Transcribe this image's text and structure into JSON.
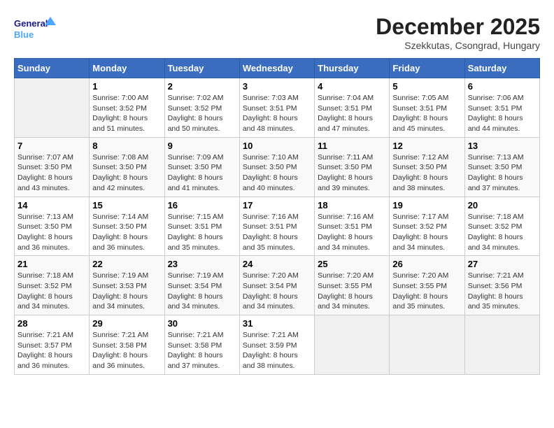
{
  "logo": {
    "line1": "General",
    "line2": "Blue"
  },
  "title": "December 2025",
  "subtitle": "Szekkutas, Csongrad, Hungary",
  "days_of_week": [
    "Sunday",
    "Monday",
    "Tuesday",
    "Wednesday",
    "Thursday",
    "Friday",
    "Saturday"
  ],
  "weeks": [
    [
      {
        "day": "",
        "empty": true
      },
      {
        "day": "1",
        "sunrise": "7:00 AM",
        "sunset": "3:52 PM",
        "daylight": "8 hours and 51 minutes."
      },
      {
        "day": "2",
        "sunrise": "7:02 AM",
        "sunset": "3:52 PM",
        "daylight": "8 hours and 50 minutes."
      },
      {
        "day": "3",
        "sunrise": "7:03 AM",
        "sunset": "3:51 PM",
        "daylight": "8 hours and 48 minutes."
      },
      {
        "day": "4",
        "sunrise": "7:04 AM",
        "sunset": "3:51 PM",
        "daylight": "8 hours and 47 minutes."
      },
      {
        "day": "5",
        "sunrise": "7:05 AM",
        "sunset": "3:51 PM",
        "daylight": "8 hours and 45 minutes."
      },
      {
        "day": "6",
        "sunrise": "7:06 AM",
        "sunset": "3:51 PM",
        "daylight": "8 hours and 44 minutes."
      }
    ],
    [
      {
        "day": "7",
        "sunrise": "7:07 AM",
        "sunset": "3:50 PM",
        "daylight": "8 hours and 43 minutes."
      },
      {
        "day": "8",
        "sunrise": "7:08 AM",
        "sunset": "3:50 PM",
        "daylight": "8 hours and 42 minutes."
      },
      {
        "day": "9",
        "sunrise": "7:09 AM",
        "sunset": "3:50 PM",
        "daylight": "8 hours and 41 minutes."
      },
      {
        "day": "10",
        "sunrise": "7:10 AM",
        "sunset": "3:50 PM",
        "daylight": "8 hours and 40 minutes."
      },
      {
        "day": "11",
        "sunrise": "7:11 AM",
        "sunset": "3:50 PM",
        "daylight": "8 hours and 39 minutes."
      },
      {
        "day": "12",
        "sunrise": "7:12 AM",
        "sunset": "3:50 PM",
        "daylight": "8 hours and 38 minutes."
      },
      {
        "day": "13",
        "sunrise": "7:13 AM",
        "sunset": "3:50 PM",
        "daylight": "8 hours and 37 minutes."
      }
    ],
    [
      {
        "day": "14",
        "sunrise": "7:13 AM",
        "sunset": "3:50 PM",
        "daylight": "8 hours and 36 minutes."
      },
      {
        "day": "15",
        "sunrise": "7:14 AM",
        "sunset": "3:50 PM",
        "daylight": "8 hours and 36 minutes."
      },
      {
        "day": "16",
        "sunrise": "7:15 AM",
        "sunset": "3:51 PM",
        "daylight": "8 hours and 35 minutes."
      },
      {
        "day": "17",
        "sunrise": "7:16 AM",
        "sunset": "3:51 PM",
        "daylight": "8 hours and 35 minutes."
      },
      {
        "day": "18",
        "sunrise": "7:16 AM",
        "sunset": "3:51 PM",
        "daylight": "8 hours and 34 minutes."
      },
      {
        "day": "19",
        "sunrise": "7:17 AM",
        "sunset": "3:52 PM",
        "daylight": "8 hours and 34 minutes."
      },
      {
        "day": "20",
        "sunrise": "7:18 AM",
        "sunset": "3:52 PM",
        "daylight": "8 hours and 34 minutes."
      }
    ],
    [
      {
        "day": "21",
        "sunrise": "7:18 AM",
        "sunset": "3:52 PM",
        "daylight": "8 hours and 34 minutes."
      },
      {
        "day": "22",
        "sunrise": "7:19 AM",
        "sunset": "3:53 PM",
        "daylight": "8 hours and 34 minutes."
      },
      {
        "day": "23",
        "sunrise": "7:19 AM",
        "sunset": "3:54 PM",
        "daylight": "8 hours and 34 minutes."
      },
      {
        "day": "24",
        "sunrise": "7:20 AM",
        "sunset": "3:54 PM",
        "daylight": "8 hours and 34 minutes."
      },
      {
        "day": "25",
        "sunrise": "7:20 AM",
        "sunset": "3:55 PM",
        "daylight": "8 hours and 34 minutes."
      },
      {
        "day": "26",
        "sunrise": "7:20 AM",
        "sunset": "3:55 PM",
        "daylight": "8 hours and 35 minutes."
      },
      {
        "day": "27",
        "sunrise": "7:21 AM",
        "sunset": "3:56 PM",
        "daylight": "8 hours and 35 minutes."
      }
    ],
    [
      {
        "day": "28",
        "sunrise": "7:21 AM",
        "sunset": "3:57 PM",
        "daylight": "8 hours and 36 minutes."
      },
      {
        "day": "29",
        "sunrise": "7:21 AM",
        "sunset": "3:58 PM",
        "daylight": "8 hours and 36 minutes."
      },
      {
        "day": "30",
        "sunrise": "7:21 AM",
        "sunset": "3:58 PM",
        "daylight": "8 hours and 37 minutes."
      },
      {
        "day": "31",
        "sunrise": "7:21 AM",
        "sunset": "3:59 PM",
        "daylight": "8 hours and 38 minutes."
      },
      {
        "day": "",
        "empty": true
      },
      {
        "day": "",
        "empty": true
      },
      {
        "day": "",
        "empty": true
      }
    ]
  ],
  "labels": {
    "sunrise": "Sunrise:",
    "sunset": "Sunset:",
    "daylight": "Daylight:"
  }
}
